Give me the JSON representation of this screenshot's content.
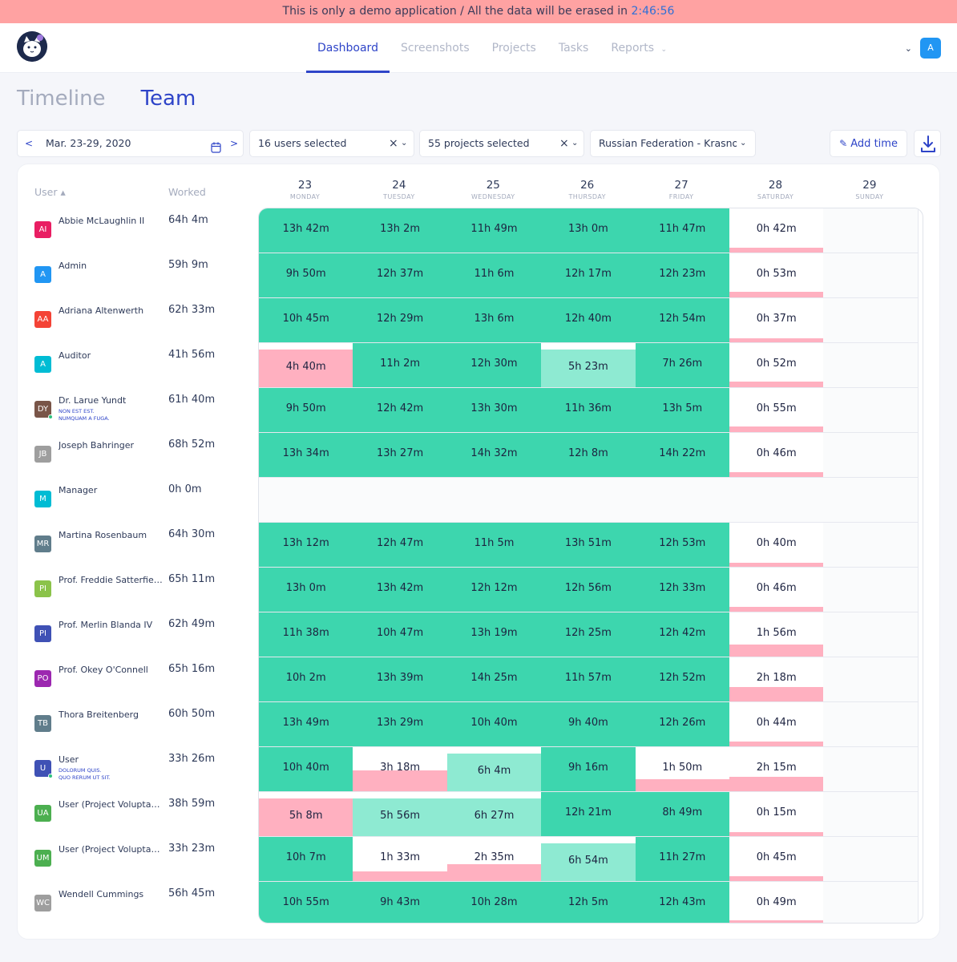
{
  "banner": {
    "text": "This is only a demo application / All the data will be erased in",
    "timer": "2:46:56"
  },
  "nav": {
    "items": [
      "Dashboard",
      "Screenshots",
      "Projects",
      "Tasks",
      "Reports"
    ],
    "active": "Dashboard"
  },
  "user_avatar": "A",
  "tabs": {
    "timeline": "Timeline",
    "team": "Team"
  },
  "filters": {
    "date_prev": "<",
    "date_next": ">",
    "date_range": "Mar. 23-29, 2020",
    "users": "16 users selected",
    "projects": "55 projects selected",
    "timezone": "Russian Federation - Krasnoy...",
    "clear": "×",
    "add_time": "Add time"
  },
  "table": {
    "header_user": "User ▴",
    "header_worked": "Worked",
    "days": [
      {
        "num": "23",
        "name": "MONDAY"
      },
      {
        "num": "24",
        "name": "TUESDAY"
      },
      {
        "num": "25",
        "name": "WEDNESDAY"
      },
      {
        "num": "26",
        "name": "THURSDAY"
      },
      {
        "num": "27",
        "name": "FRIDAY"
      },
      {
        "num": "28",
        "name": "SATURDAY"
      },
      {
        "num": "29",
        "name": "SUNDAY"
      }
    ],
    "users": [
      {
        "initials": "AI",
        "color": "#e91e63",
        "name": "Abbie McLaughlin II",
        "worked": "64h 4m",
        "cells": [
          "13h 42m",
          "13h 2m",
          "11h 49m",
          "13h 0m",
          "11h 47m",
          "0h 42m",
          ""
        ]
      },
      {
        "initials": "A",
        "color": "#2196f3",
        "name": "Admin",
        "worked": "59h 9m",
        "cells": [
          "9h 50m",
          "12h 37m",
          "11h 6m",
          "12h 17m",
          "12h 23m",
          "0h 53m",
          ""
        ]
      },
      {
        "initials": "AA",
        "color": "#f44336",
        "name": "Adriana Altenwerth",
        "worked": "62h 33m",
        "cells": [
          "10h 45m",
          "12h 29m",
          "13h 6m",
          "12h 40m",
          "12h 54m",
          "0h 37m",
          ""
        ]
      },
      {
        "initials": "A",
        "color": "#00bcd4",
        "name": "Auditor",
        "worked": "41h 56m",
        "cells": [
          "4h 40m",
          "11h 2m",
          "12h 30m",
          "5h 23m",
          "7h 26m",
          "0h 52m",
          ""
        ]
      },
      {
        "initials": "DY",
        "color": "#795548",
        "name": "Dr. Larue Yundt",
        "sub1": "NON EST EST.",
        "sub2": "NUMQUAM A FUGA.",
        "online": true,
        "worked": "61h 40m",
        "cells": [
          "9h 50m",
          "12h 42m",
          "13h 30m",
          "11h 36m",
          "13h 5m",
          "0h 55m",
          ""
        ]
      },
      {
        "initials": "JB",
        "color": "#9e9e9e",
        "name": "Joseph Bahringer",
        "worked": "68h 52m",
        "cells": [
          "13h 34m",
          "13h 27m",
          "14h 32m",
          "12h 8m",
          "14h 22m",
          "0h 46m",
          ""
        ]
      },
      {
        "initials": "M",
        "color": "#00bcd4",
        "name": "Manager",
        "worked": "0h 0m",
        "cells": [
          "",
          "",
          "",
          "",
          "",
          "",
          ""
        ]
      },
      {
        "initials": "MR",
        "color": "#607d8b",
        "name": "Martina Rosenbaum",
        "worked": "64h 30m",
        "cells": [
          "13h 12m",
          "12h 47m",
          "11h 5m",
          "13h 51m",
          "12h 53m",
          "0h 40m",
          ""
        ]
      },
      {
        "initials": "PI",
        "color": "#8bc34a",
        "name": "Prof. Freddie Satterfield I",
        "worked": "65h 11m",
        "cells": [
          "13h 0m",
          "13h 42m",
          "12h 12m",
          "12h 56m",
          "12h 33m",
          "0h 46m",
          ""
        ]
      },
      {
        "initials": "PI",
        "color": "#3f51b5",
        "name": "Prof. Merlin Blanda IV",
        "worked": "62h 49m",
        "cells": [
          "11h 38m",
          "10h 47m",
          "13h 19m",
          "12h 25m",
          "12h 42m",
          "1h 56m",
          ""
        ]
      },
      {
        "initials": "PO",
        "color": "#9c27b0",
        "name": "Prof. Okey O'Connell",
        "worked": "65h 16m",
        "cells": [
          "10h 2m",
          "13h 39m",
          "14h 25m",
          "11h 57m",
          "12h 52m",
          "2h 18m",
          ""
        ]
      },
      {
        "initials": "TB",
        "color": "#607d8b",
        "name": "Thora Breitenberg",
        "worked": "60h 50m",
        "cells": [
          "13h 49m",
          "13h 29m",
          "10h 40m",
          "9h 40m",
          "12h 26m",
          "0h 44m",
          ""
        ]
      },
      {
        "initials": "U",
        "color": "#3f51b5",
        "name": "User",
        "sub1": "DOLORUM QUIS.",
        "sub2": "QUO RERUM UT SIT.",
        "online": true,
        "worked": "33h 26m",
        "cells": [
          "10h 40m",
          "3h 18m",
          "6h 4m",
          "9h 16m",
          "1h 50m",
          "2h 15m",
          ""
        ]
      },
      {
        "initials": "UA",
        "color": "#4caf50",
        "name": "User (Project Voluptas est)",
        "worked": "38h 59m",
        "cells": [
          "5h 8m",
          "5h 56m",
          "6h 27m",
          "12h 21m",
          "8h 49m",
          "0h 15m",
          ""
        ]
      },
      {
        "initials": "UM",
        "color": "#4caf50",
        "name": "User (Project Voluptas est)",
        "worked": "33h 23m",
        "cells": [
          "10h 7m",
          "1h 33m",
          "2h 35m",
          "6h 54m",
          "11h 27m",
          "0h 45m",
          ""
        ]
      },
      {
        "initials": "WC",
        "color": "#9e9e9e",
        "name": "Wendell Cummings",
        "worked": "56h 45m",
        "cells": [
          "10h 55m",
          "9h 43m",
          "10h 28m",
          "12h 5m",
          "12h 43m",
          "0h 49m",
          ""
        ]
      }
    ]
  },
  "colors": {
    "full": "#3dd6ae",
    "partial": "#8eead2",
    "low_bar": "#ffb0c0",
    "accent": "#2e44c8"
  }
}
